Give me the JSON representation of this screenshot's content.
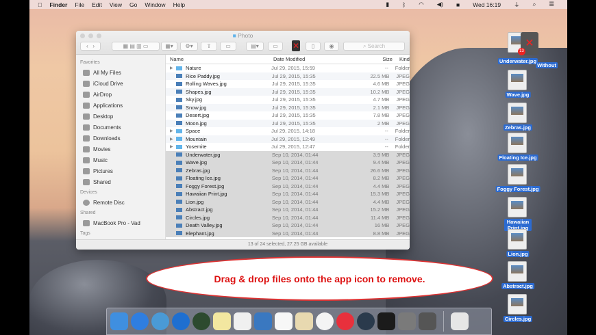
{
  "menubar": {
    "app": "Finder",
    "items": [
      "File",
      "Edit",
      "View",
      "Go",
      "Window",
      "Help"
    ],
    "clock": "Wed 16:19"
  },
  "window": {
    "title": "Photo",
    "search_placeholder": "Search",
    "sidebar": {
      "favorites_header": "Favorites",
      "favorites": [
        "All My Files",
        "iCloud Drive",
        "AirDrop",
        "Applications",
        "Desktop",
        "Documents",
        "Downloads",
        "Movies",
        "Music",
        "Pictures",
        "Shared"
      ],
      "devices_header": "Devices",
      "devices": [
        "Remote Disc"
      ],
      "shared_header": "Shared",
      "shared": [
        "MacBook Pro - Vad"
      ],
      "tags_header": "Tags"
    },
    "columns": {
      "name": "Name",
      "date": "Date Modified",
      "size": "Size",
      "kind": "Kind"
    },
    "rows": [
      {
        "name": "Nature",
        "date": "Jul 29, 2015, 15:59",
        "size": "--",
        "kind": "Folder",
        "folder": true,
        "sel": false
      },
      {
        "name": "Rice Paddy.jpg",
        "date": "Jul 29, 2015, 15:35",
        "size": "22.5 MB",
        "kind": "JPEG",
        "sel": false
      },
      {
        "name": "Rolling Waves.jpg",
        "date": "Jul 29, 2015, 15:35",
        "size": "4.6 MB",
        "kind": "JPEG",
        "sel": false
      },
      {
        "name": "Shapes.jpg",
        "date": "Jul 29, 2015, 15:35",
        "size": "10.2 MB",
        "kind": "JPEG",
        "sel": false
      },
      {
        "name": "Sky.jpg",
        "date": "Jul 29, 2015, 15:35",
        "size": "4.7 MB",
        "kind": "JPEG",
        "sel": false
      },
      {
        "name": "Snow.jpg",
        "date": "Jul 29, 2015, 15:35",
        "size": "2.1 MB",
        "kind": "JPEG",
        "sel": false
      },
      {
        "name": "Desert.jpg",
        "date": "Jul 29, 2015, 15:35",
        "size": "7.8 MB",
        "kind": "JPEG",
        "sel": false
      },
      {
        "name": "Moon.jpg",
        "date": "Jul 29, 2015, 15:35",
        "size": "2 MB",
        "kind": "JPEG",
        "sel": false
      },
      {
        "name": "Space",
        "date": "Jul 29, 2015, 14:18",
        "size": "--",
        "kind": "Folder",
        "folder": true,
        "sel": false
      },
      {
        "name": "Mountain",
        "date": "Jul 29, 2015, 12:49",
        "size": "--",
        "kind": "Folder",
        "folder": true,
        "sel": false
      },
      {
        "name": "Yosemite",
        "date": "Jul 29, 2015, 12:47",
        "size": "--",
        "kind": "Folder",
        "folder": true,
        "sel": false
      },
      {
        "name": "Underwater.jpg",
        "date": "Sep 10, 2014, 01:44",
        "size": "3.9 MB",
        "kind": "JPEG",
        "sel": true
      },
      {
        "name": "Wave.jpg",
        "date": "Sep 10, 2014, 01:44",
        "size": "9.4 MB",
        "kind": "JPEG",
        "sel": true
      },
      {
        "name": "Zebras.jpg",
        "date": "Sep 10, 2014, 01:44",
        "size": "26.6 MB",
        "kind": "JPEG",
        "sel": true
      },
      {
        "name": "Floating Ice.jpg",
        "date": "Sep 10, 2014, 01:44",
        "size": "8.2 MB",
        "kind": "JPEG",
        "sel": true
      },
      {
        "name": "Foggy Forest.jpg",
        "date": "Sep 10, 2014, 01:44",
        "size": "4.4 MB",
        "kind": "JPEG",
        "sel": true
      },
      {
        "name": "Hawaiian Print.jpg",
        "date": "Sep 10, 2014, 01:44",
        "size": "15.3 MB",
        "kind": "JPEG",
        "sel": true
      },
      {
        "name": "Lion.jpg",
        "date": "Sep 10, 2014, 01:44",
        "size": "4.4 MB",
        "kind": "JPEG",
        "sel": true
      },
      {
        "name": "Abstract.jpg",
        "date": "Sep 10, 2014, 01:44",
        "size": "15.2 MB",
        "kind": "JPEG",
        "sel": true
      },
      {
        "name": "Circles.jpg",
        "date": "Sep 10, 2014, 01:44",
        "size": "11.4 MB",
        "kind": "JPEG",
        "sel": true
      },
      {
        "name": "Death Valley.jpg",
        "date": "Sep 10, 2014, 01:44",
        "size": "16 MB",
        "kind": "JPEG",
        "sel": true
      },
      {
        "name": "Elephant.jpg",
        "date": "Sep 10, 2014, 01:44",
        "size": "8.8 MB",
        "kind": "JPEG",
        "sel": true
      }
    ],
    "status": "13 of 24 selected, 27.25 GB available"
  },
  "desktop": {
    "drag_badge": "13",
    "drag_app_label": "Without",
    "icons": [
      "Underwater.jpg",
      "Wave.jpg",
      "Zebras.jpg",
      "Floating Ice.jpg",
      "Foggy Forest.jpg",
      "Hawaiian Print.jpg",
      "Lion.jpg",
      "Abstract.jpg",
      "Circles.jpg"
    ],
    "icon_kind": "JPEG"
  },
  "callout": "Drag & drop files onto the app icon to remove.",
  "dock": {
    "apps": [
      "finder",
      "safari",
      "sync-1",
      "sync-2",
      "sync-3",
      "textedit",
      "vpn",
      "preview",
      "notes",
      "maps",
      "photos",
      "itunes",
      "quicktime",
      "terminal",
      "system-preferences",
      "app-trash",
      "trash"
    ],
    "colors": [
      "#3f8fe0",
      "#2f7ee0",
      "#4a9ad6",
      "#1f6fd0",
      "#2d4a2f",
      "#f3e7a0",
      "#f0f0f0",
      "#3a78c0",
      "#f7f7f7",
      "#e8d9b0",
      "#f4f4f4",
      "#e8303c",
      "#2a3a4c",
      "#1b1b1b",
      "#7a7a7a",
      "#555",
      "#e6e6e6"
    ]
  }
}
